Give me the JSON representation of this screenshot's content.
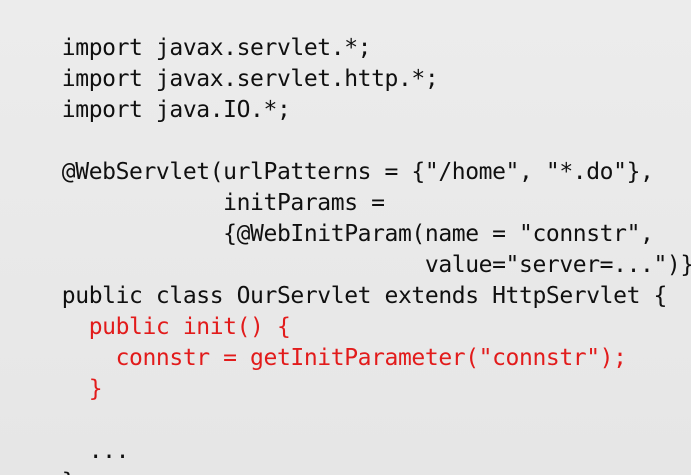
{
  "code": {
    "lines": [
      {
        "text": "import javax.servlet.*;",
        "highlight": false
      },
      {
        "text": "import javax.servlet.http.*;",
        "highlight": false
      },
      {
        "text": "import java.IO.*;",
        "highlight": false
      },
      {
        "text": "",
        "highlight": false
      },
      {
        "text": "@WebServlet(urlPatterns = {\"/home\", \"*.do\"},",
        "highlight": false
      },
      {
        "text": "            initParams =",
        "highlight": false
      },
      {
        "text": "            {@WebInitParam(name = \"connstr\",",
        "highlight": false
      },
      {
        "text": "                           value=\"server=...\")})",
        "highlight": false
      },
      {
        "text": "public class OurServlet extends HttpServlet {",
        "highlight": false
      },
      {
        "text": "  public init() {",
        "highlight": true
      },
      {
        "text": "    connstr = getInitParameter(\"connstr\");",
        "highlight": true
      },
      {
        "text": "  }",
        "highlight": true
      },
      {
        "text": "",
        "highlight": false
      },
      {
        "text": "  ...",
        "highlight": false
      },
      {
        "text": "}",
        "highlight": false
      }
    ]
  },
  "colors": {
    "background": "#e9e9e9",
    "text": "#101010",
    "highlight": "#e21b1b"
  }
}
